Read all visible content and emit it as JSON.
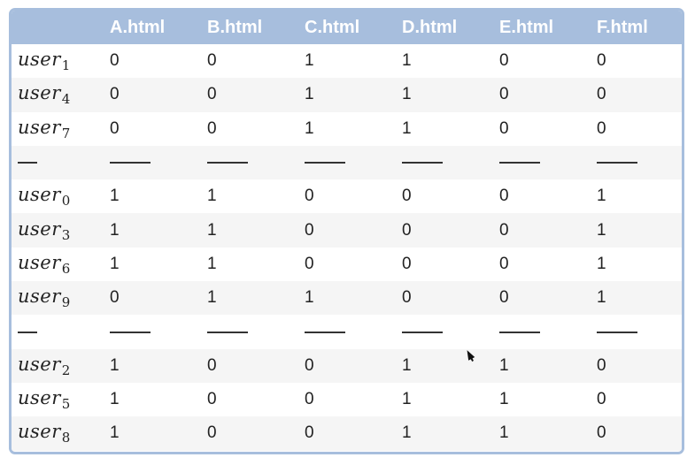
{
  "table": {
    "columns": [
      "",
      "A.html",
      "B.html",
      "C.html",
      "D.html",
      "E.html",
      "F.html"
    ],
    "rows": [
      {
        "kind": "user",
        "base": "user",
        "sub": "1",
        "values": [
          "0",
          "0",
          "1",
          "1",
          "0",
          "0"
        ]
      },
      {
        "kind": "user",
        "base": "user",
        "sub": "4",
        "values": [
          "0",
          "0",
          "1",
          "1",
          "0",
          "0"
        ]
      },
      {
        "kind": "user",
        "base": "user",
        "sub": "7",
        "values": [
          "0",
          "0",
          "1",
          "1",
          "0",
          "0"
        ]
      },
      {
        "kind": "separator"
      },
      {
        "kind": "user",
        "base": "user",
        "sub": "0",
        "values": [
          "1",
          "1",
          "0",
          "0",
          "0",
          "1"
        ]
      },
      {
        "kind": "user",
        "base": "user",
        "sub": "3",
        "values": [
          "1",
          "1",
          "0",
          "0",
          "0",
          "1"
        ]
      },
      {
        "kind": "user",
        "base": "user",
        "sub": "6",
        "values": [
          "1",
          "1",
          "0",
          "0",
          "0",
          "1"
        ]
      },
      {
        "kind": "user",
        "base": "user",
        "sub": "9",
        "values": [
          "0",
          "1",
          "1",
          "0",
          "0",
          "1"
        ]
      },
      {
        "kind": "separator"
      },
      {
        "kind": "user",
        "base": "user",
        "sub": "2",
        "values": [
          "1",
          "0",
          "0",
          "1",
          "1",
          "0"
        ]
      },
      {
        "kind": "user",
        "base": "user",
        "sub": "5",
        "values": [
          "1",
          "0",
          "0",
          "1",
          "1",
          "0"
        ]
      },
      {
        "kind": "user",
        "base": "user",
        "sub": "8",
        "values": [
          "1",
          "0",
          "0",
          "1",
          "1",
          "0"
        ]
      }
    ]
  },
  "colors": {
    "header_bg": "#a7bedd",
    "header_text": "#ffffff",
    "stripe": "#f5f5f5"
  },
  "icons": {
    "cursor": "mouse-pointer-icon"
  }
}
